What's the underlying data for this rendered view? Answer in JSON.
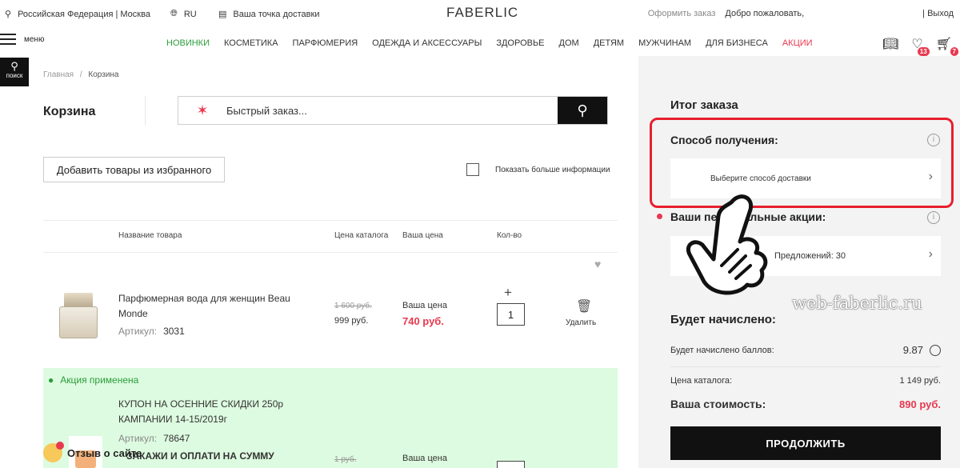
{
  "topbar": {
    "region": "Российская Федерация | Москва",
    "lang": "RU",
    "delivery_point": "Ваша точка доставки",
    "logo": "FABERLIC",
    "checkout": "Оформить заказ",
    "welcome": "Добро пожаловать,",
    "exit": "| Выход"
  },
  "nav": {
    "menu": "меню",
    "items": [
      "НОВИНКИ",
      "КОСМЕТИКА",
      "ПАРФЮМЕРИЯ",
      "ОДЕЖДА И АКСЕССУАРЫ",
      "ЗДОРОВЬЕ",
      "ДОМ",
      "ДЕТЯМ",
      "МУЖЧИНАМ",
      "ДЛЯ БИЗНЕСА",
      "АКЦИИ"
    ],
    "favorites_count": "13",
    "cart_count": "7",
    "search_label": "поиск"
  },
  "breadcrumb": {
    "home": "Главная",
    "sep": "/",
    "current": "Корзина"
  },
  "page_title": "Корзина",
  "quick_order": {
    "placeholder": "Быстрый заказ..."
  },
  "add_from_favorites": "Добавить товары из избранного",
  "show_more_info": "Показать больше информации",
  "table": {
    "headers": {
      "name": "Название товара",
      "catalog_price": "Цена каталога",
      "your_price": "Ваша цена",
      "qty": "Кол-во"
    },
    "row1": {
      "name_line1": "Парфюмерная вода для женщин Beau",
      "name_line2": "Monde",
      "article_label": "Артикул:",
      "article": "3031",
      "old_price": "1 600 руб.",
      "catalog_price": "999 руб.",
      "your_price_label": "Ваша цена",
      "your_price": "740 руб.",
      "plus": "+",
      "qty": "1",
      "delete": "Удалить"
    },
    "promo": {
      "applied": "Акция применена",
      "coupon_line1": "КУПОН НА ОСЕННИЕ СКИДКИ 250р",
      "coupon_line2": "КАМПАНИИ 14-15/2019г",
      "article_label": "Артикул:",
      "article": "78647",
      "next_item": "ЗАКАЖИ И ОПЛАТИ НА СУММУ",
      "next_old_price": "1 руб.",
      "next_your_price_label": "Ваша цена"
    }
  },
  "review": "Отзыв о сайте",
  "summary": {
    "title": "Итог заказа",
    "delivery_title": "Способ получения:",
    "delivery_select": "Выберите способ доставки",
    "promos_title": "Ваши персональные акции:",
    "promos_text": "Предложений: 30",
    "earned_title": "Будет начислено:",
    "points_label": "Будет начислено баллов:",
    "points_value": "9.87",
    "catalog_label": "Цена каталога:",
    "catalog_value": "1 149 руб.",
    "cost_label": "Ваша стоимость:",
    "cost_value": "890 руб.",
    "continue": "ПРОДОЛЖИТЬ",
    "watermark": "web-faberlic.ru"
  },
  "colors": {
    "accent_red": "#e8384f",
    "nav_green": "#2a9d3a",
    "promo_bg": "#ddfbe0",
    "highlight_frame": "#e81f2d"
  }
}
